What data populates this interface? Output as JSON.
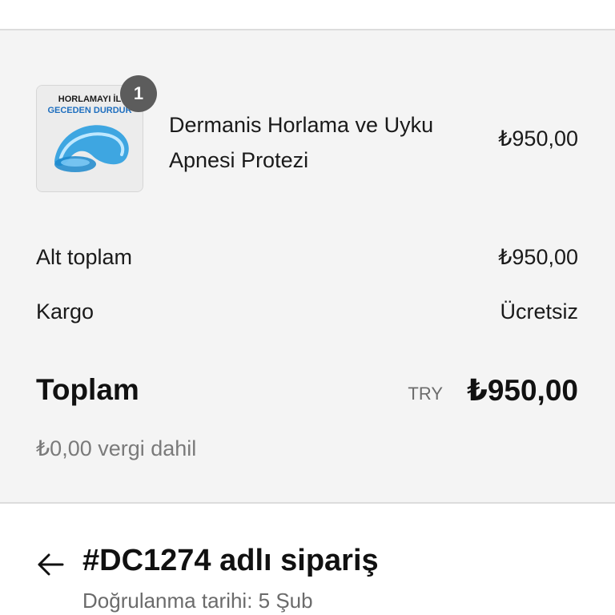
{
  "product": {
    "name": "Dermanis Horlama ve Uyku Apnesi Protezi",
    "price": "₺950,00",
    "quantity": "1",
    "image_text_line1": "HORLAMAYI İL",
    "image_text_line2": "GECEDEN DURDUR",
    "image_icon": "mouthguard-product-image"
  },
  "summary": {
    "subtotal_label": "Alt toplam",
    "subtotal_value": "₺950,00",
    "shipping_label": "Kargo",
    "shipping_value": "Ücretsiz",
    "total_label": "Toplam",
    "total_currency": "TRY",
    "total_value": "₺950,00",
    "tax_note": "₺0,00 vergi dahil"
  },
  "order": {
    "back_icon": "arrow-left-icon",
    "title": "#DC1274 adlı sipariş",
    "confirmed_date": "Doğrulanma tarihi: 5 Şub"
  },
  "colors": {
    "summary_bg": "#f4f4f4",
    "badge_bg": "#5c5c5c",
    "product_blue": "#2b9fe0"
  }
}
